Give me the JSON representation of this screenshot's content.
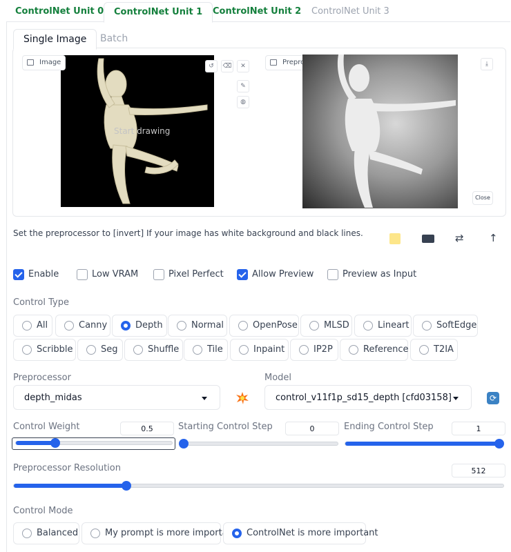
{
  "unit_tabs": [
    "ControlNet Unit 0",
    "ControlNet Unit 1",
    "ControlNet Unit 2",
    "ControlNet Unit 3"
  ],
  "image_tabs": [
    "Single Image",
    "Batch"
  ],
  "image_panel": {
    "image_label": "Image",
    "overlay_text": "Start drawing",
    "preview_label": "Preprocessor Preview",
    "close_label": "Close"
  },
  "hint_text": "Set the preprocessor to [invert] If your image has white background and black lines.",
  "checkboxes": [
    {
      "label": "Enable",
      "checked": true
    },
    {
      "label": "Low VRAM",
      "checked": false
    },
    {
      "label": "Pixel Perfect",
      "checked": false
    },
    {
      "label": "Allow Preview",
      "checked": true
    },
    {
      "label": "Preview as Input",
      "checked": false
    }
  ],
  "control_type": {
    "label": "Control Type",
    "options": [
      "All",
      "Canny",
      "Depth",
      "Normal",
      "OpenPose",
      "MLSD",
      "Lineart",
      "SoftEdge",
      "Scribble",
      "Seg",
      "Shuffle",
      "Tile",
      "Inpaint",
      "IP2P",
      "Reference",
      "T2IA"
    ],
    "selected": "Depth"
  },
  "preprocessor": {
    "label": "Preprocessor",
    "value": "depth_midas"
  },
  "model": {
    "label": "Model",
    "value": "control_v11f1p_sd15_depth [cfd03158]"
  },
  "sliders": {
    "control_weight": {
      "label": "Control Weight",
      "value": "0.5",
      "fraction": 0.25
    },
    "starting_step": {
      "label": "Starting Control Step",
      "value": "0",
      "fraction": 0.0
    },
    "ending_step": {
      "label": "Ending Control Step",
      "value": "1",
      "fraction": 1.0
    },
    "resolution": {
      "label": "Preprocessor Resolution",
      "value": "512",
      "fraction": 0.23
    }
  },
  "control_mode": {
    "label": "Control Mode",
    "options": [
      "Balanced",
      "My prompt is more important",
      "ControlNet is more important"
    ],
    "selected": "ControlNet is more important"
  },
  "colors": {
    "accent": "#2563eb",
    "tab_green": "#15803d"
  },
  "icons": [
    "undo-icon",
    "eraser-icon",
    "close-icon",
    "brush-icon",
    "palette-icon",
    "download-icon",
    "memo-icon",
    "camera-icon",
    "swap-icon",
    "send-up-icon",
    "explosion-icon",
    "refresh-icon"
  ]
}
